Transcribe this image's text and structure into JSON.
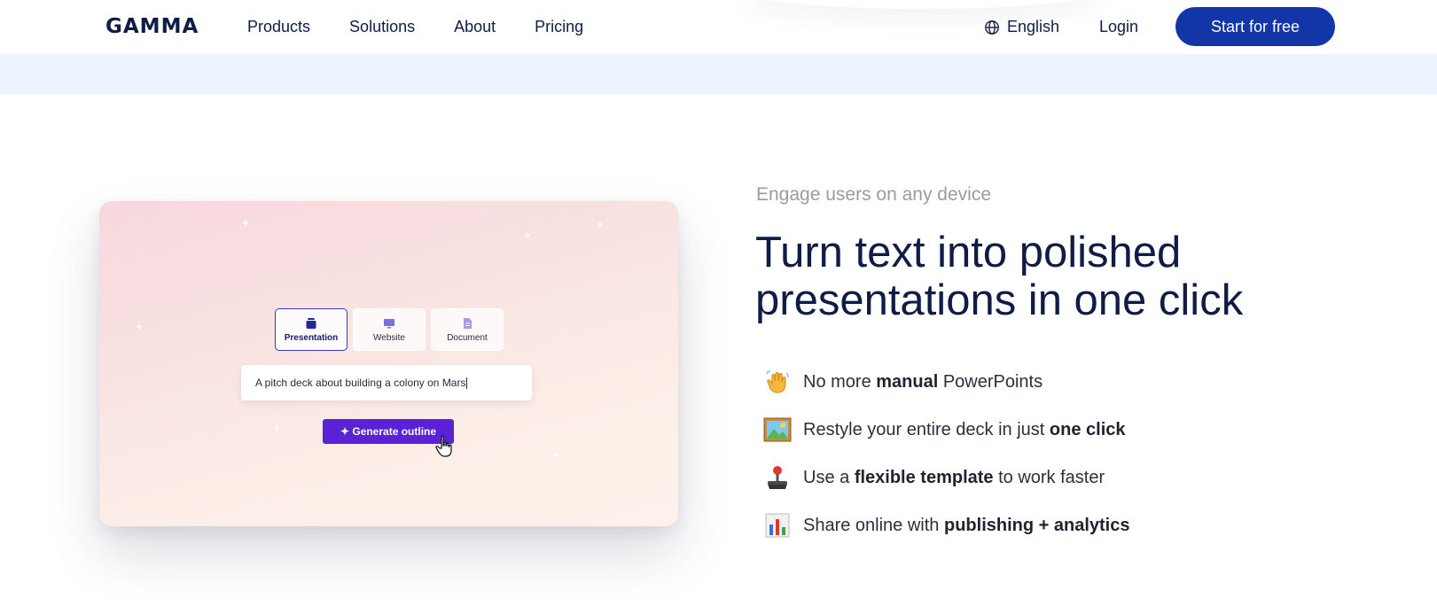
{
  "header": {
    "logo": "GAMMA",
    "nav": [
      "Products",
      "Solutions",
      "About",
      "Pricing"
    ],
    "language": "English",
    "login": "Login",
    "cta": "Start for free"
  },
  "preview": {
    "modes": [
      {
        "label": "Presentation",
        "icon": "stack-icon",
        "active": true
      },
      {
        "label": "Website",
        "icon": "monitor-icon",
        "active": false
      },
      {
        "label": "Document",
        "icon": "document-icon",
        "active": false
      }
    ],
    "prompt_value": "A pitch deck about building a colony on Mars",
    "generate_label": "✦ Generate outline"
  },
  "section": {
    "eyebrow": "Engage users on any device",
    "headline_line1": "Turn text into polished",
    "headline_line2": "presentations in one click",
    "features": [
      {
        "icon": "waving-hand-icon",
        "pre": "No more ",
        "bold": "manual",
        "post": " PowerPoints"
      },
      {
        "icon": "framed-picture-icon",
        "pre": "Restyle your entire deck in just ",
        "bold": "one click",
        "post": ""
      },
      {
        "icon": "joystick-icon",
        "pre": "Use a ",
        "bold": "flexible template",
        "post": " to work faster"
      },
      {
        "icon": "bar-chart-icon",
        "pre": "Share online with ",
        "bold": "publishing + analytics",
        "post": ""
      }
    ]
  },
  "colors": {
    "brand": "#1236a8",
    "generate": "#5a21d6",
    "heading": "#0f1d46",
    "band": "#eef4ff"
  }
}
